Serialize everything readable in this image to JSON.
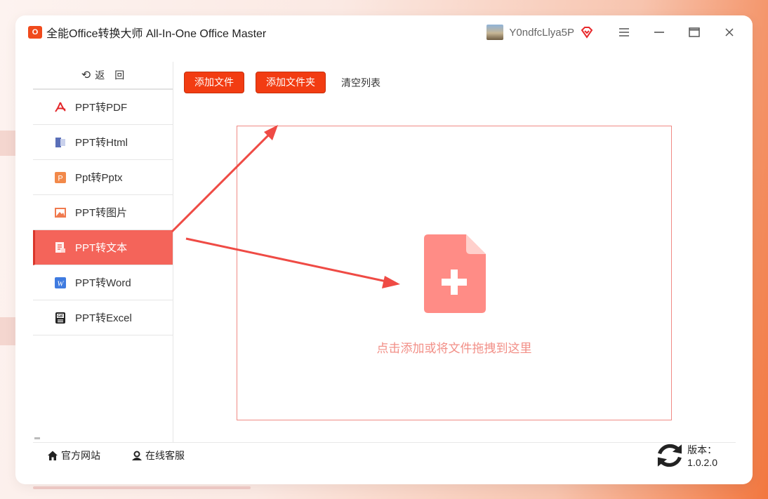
{
  "window": {
    "title": "全能Office转换大师 All-In-One Office Master",
    "username": "Y0ndfcLlya5P",
    "icons": [
      "menu-icon",
      "minimize-icon",
      "maximize-icon",
      "close-icon"
    ]
  },
  "sidebar": {
    "back_label": "返　回",
    "items": [
      {
        "label": "PPT转PDF",
        "icon": "pdf-icon"
      },
      {
        "label": "PPT转Html",
        "icon": "html-icon"
      },
      {
        "label": "Ppt转Pptx",
        "icon": "pptx-icon"
      },
      {
        "label": "PPT转图片",
        "icon": "image-icon"
      },
      {
        "label": "PPT转文本",
        "icon": "text-icon",
        "active": true
      },
      {
        "label": "PPT转Word",
        "icon": "word-icon"
      },
      {
        "label": "PPT转Excel",
        "icon": "excel-icon"
      }
    ]
  },
  "toolbar": {
    "add_file": "添加文件",
    "add_folder": "添加文件夹",
    "clear_list": "清空列表"
  },
  "dropzone": {
    "hint": "点击添加或将文件拖拽到这里"
  },
  "footer": {
    "website": "官方网站",
    "support": "在线客服",
    "version": "版本：1.0.2.0"
  },
  "colors": {
    "accent": "#f23c12",
    "active_nav": "#f4645a",
    "dropzone_border": "#f08a84",
    "arrow": "#ef4b45"
  }
}
